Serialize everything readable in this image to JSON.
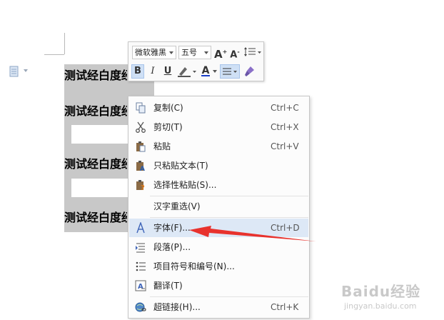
{
  "document": {
    "lines": [
      "测试经白度经",
      "测试经白度经",
      "测试经白度经",
      "测试经白度经"
    ]
  },
  "mini_toolbar": {
    "font_name": "微软雅黑",
    "font_size": "五号",
    "grow_font": "A",
    "shrink_font": "A",
    "bold": "B",
    "italic": "I",
    "underline": "U",
    "font_color": "A"
  },
  "context_menu": {
    "items": [
      {
        "label": "复制(C)",
        "shortcut": "Ctrl+C",
        "icon": "copy-icon"
      },
      {
        "label": "剪切(T)",
        "shortcut": "Ctrl+X",
        "icon": "cut-icon"
      },
      {
        "label": "粘贴",
        "shortcut": "Ctrl+V",
        "icon": "paste-icon"
      },
      {
        "label": "只粘贴文本(T)",
        "shortcut": "",
        "icon": "paste-text-icon"
      },
      {
        "label": "选择性粘贴(S)...",
        "shortcut": "",
        "icon": "paste-special-icon"
      },
      {
        "label": "汉字重选(V)",
        "shortcut": "",
        "icon": ""
      },
      {
        "label": "字体(F)...",
        "shortcut": "Ctrl+D",
        "icon": "font-icon"
      },
      {
        "label": "段落(P)...",
        "shortcut": "",
        "icon": "paragraph-icon"
      },
      {
        "label": "项目符号和编号(N)...",
        "shortcut": "",
        "icon": "bullets-icon"
      },
      {
        "label": "翻译(T)",
        "shortcut": "",
        "icon": "translate-icon"
      },
      {
        "label": "超链接(H)...",
        "shortcut": "Ctrl+K",
        "icon": "hyperlink-icon"
      }
    ]
  },
  "watermark": {
    "main": "Baidu经验",
    "sub": "jingyan.baidu.com"
  },
  "colors": {
    "selection": "#c8c8c8",
    "menu_highlight": "#dde8f6",
    "arrow": "#e8322d",
    "font_color_bar": "#1a3ec8"
  }
}
